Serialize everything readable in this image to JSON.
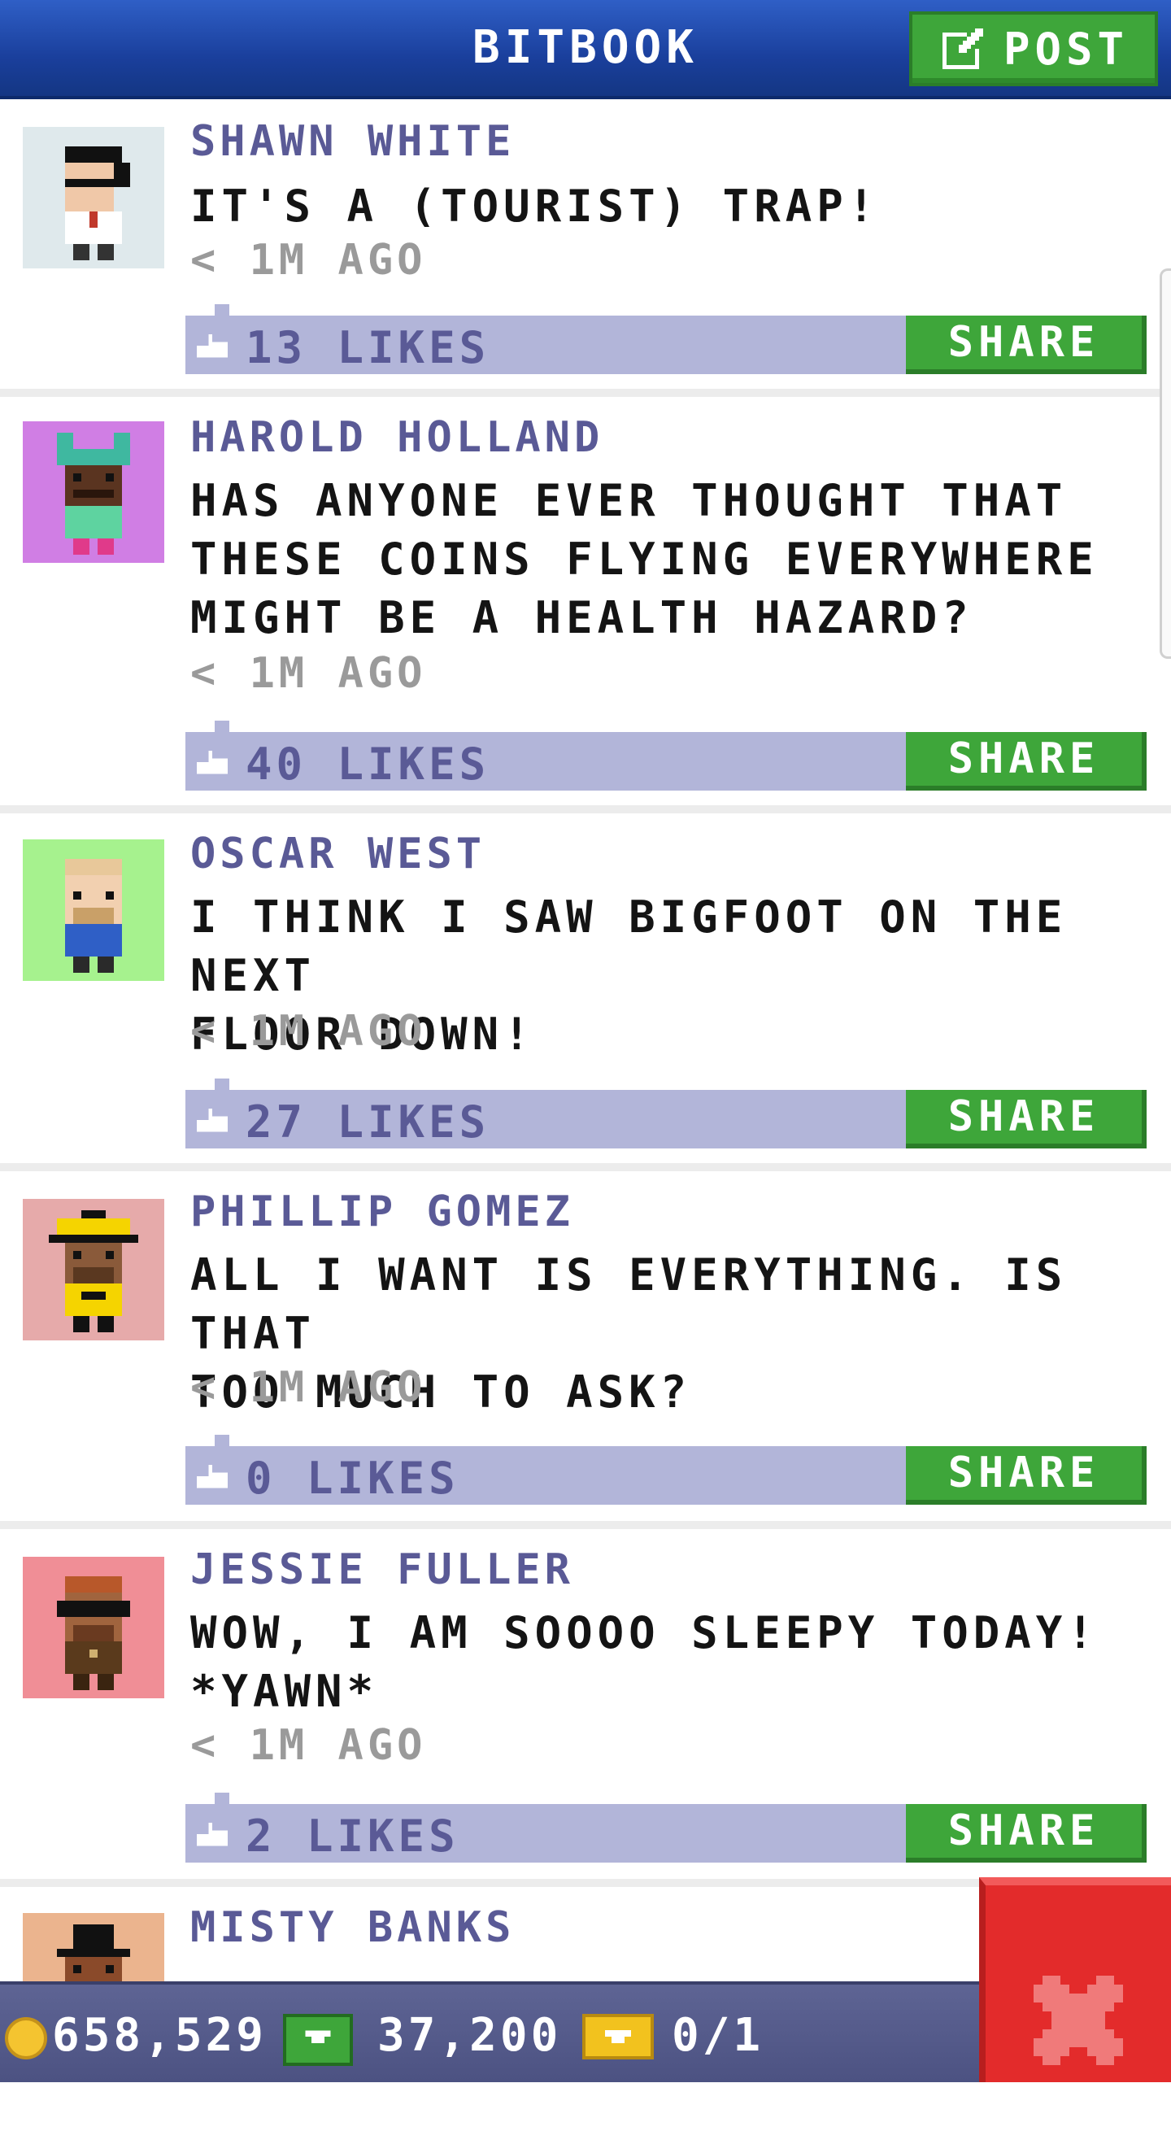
{
  "header": {
    "title": "BITBOOK",
    "post_label": "POST",
    "post_icon": "compose-icon"
  },
  "posts": [
    {
      "name": "SHAWN WHITE",
      "text": "IT'S A (TOURIST) TRAP!",
      "time": "< 1M AGO",
      "likes": "13 LIKES",
      "share": "SHARE",
      "avatar_bg": "#dfe9ec"
    },
    {
      "name": "HAROLD HOLLAND",
      "text": "HAS ANYONE EVER THOUGHT THAT\nTHESE COINS FLYING EVERYWHERE\nMIGHT BE A HEALTH HAZARD?",
      "time": "< 1M AGO",
      "likes": "40 LIKES",
      "share": "SHARE",
      "avatar_bg": "#d07ee4"
    },
    {
      "name": "OSCAR WEST",
      "text": "I THINK I SAW BIGFOOT ON THE NEXT\nFLOOR DOWN!",
      "time": "< 1M AGO",
      "likes": "27 LIKES",
      "share": "SHARE",
      "avatar_bg": "#a6f28e"
    },
    {
      "name": "PHILLIP GOMEZ",
      "text": "ALL I WANT IS EVERYTHING. IS THAT\nTOO MUCH TO ASK?",
      "time": "< 1M AGO",
      "likes": "0 LIKES",
      "share": "SHARE",
      "avatar_bg": "#e6aaaa"
    },
    {
      "name": "JESSIE FULLER",
      "text": "WOW, I AM SOOOO SLEEPY TODAY!\n*YAWN*",
      "time": "< 1M AGO",
      "likes": "2 LIKES",
      "share": "SHARE",
      "avatar_bg": "#f08e96"
    },
    {
      "name": "MISTY BANKS",
      "avatar_bg": "#ebb48e"
    }
  ],
  "bottom_bar": {
    "coins": "658,529",
    "bux": "37,200",
    "tickets": "0/1",
    "coin_icon": "coin-icon",
    "bux_icon": "bux-icon",
    "ticket_icon": "ticket-icon"
  },
  "close_icon": "close-icon",
  "colors": {
    "header_blue": "#1a3f9c",
    "button_green": "#3ea63a",
    "like_bar": "#b2b5d9",
    "name_purple": "#5a5a96",
    "close_red": "#e32b2b"
  }
}
